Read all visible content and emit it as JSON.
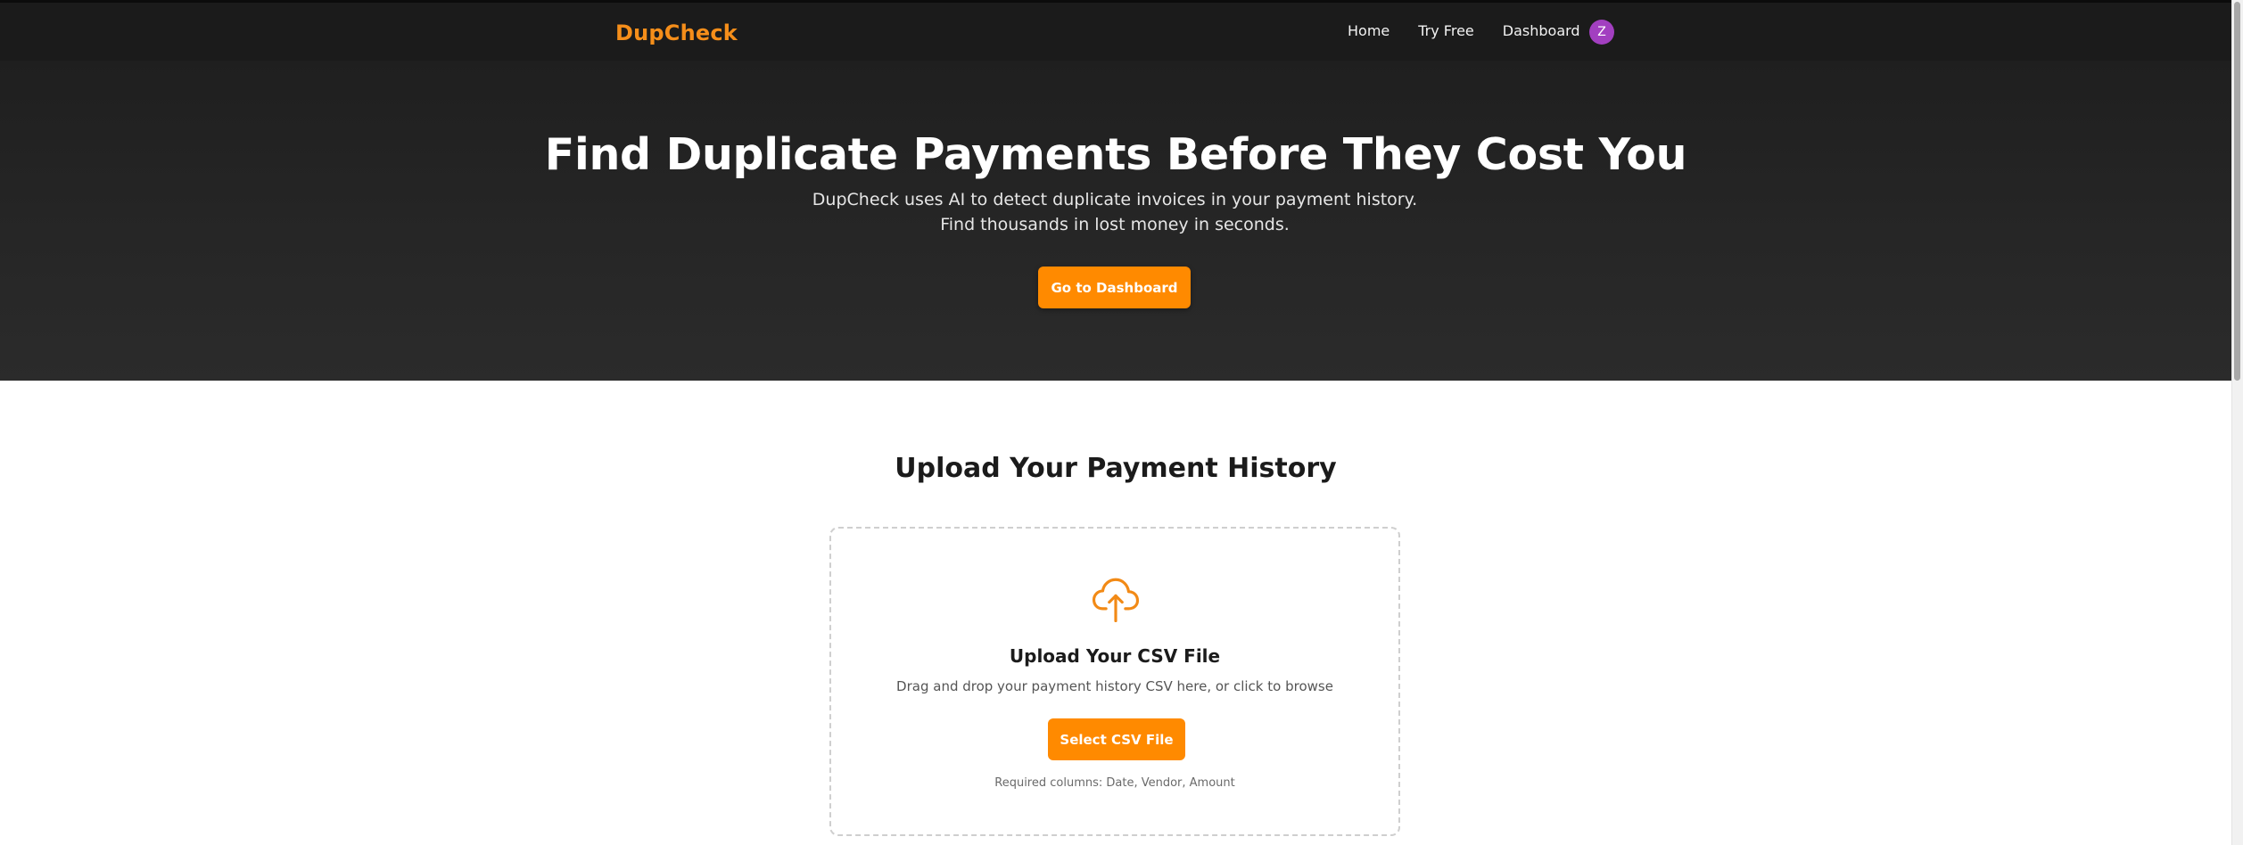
{
  "brand": {
    "name": "DupCheck"
  },
  "nav": {
    "links": [
      "Home",
      "Try Free",
      "Dashboard"
    ],
    "avatar_initial": "Z"
  },
  "hero": {
    "title": "Find Duplicate Payments Before They Cost You",
    "subtitle": "DupCheck uses AI to detect duplicate invoices in your payment history. Find thousands in lost money in seconds.",
    "cta_label": "Go to Dashboard"
  },
  "upload": {
    "section_title": "Upload Your Payment History",
    "title": "Upload Your CSV File",
    "description": "Drag and drop your payment history CSV here, or click to browse",
    "button_label": "Select CSV File",
    "required_columns": "Required columns: Date, Vendor, Amount",
    "icon": "cloud-upload-icon"
  },
  "colors": {
    "accent": "#ff8a00",
    "brand": "#f58e1a",
    "nav_bg": "#1b1b1b",
    "hero_bg": "#262626",
    "avatar_bg": "#a23fc0"
  }
}
